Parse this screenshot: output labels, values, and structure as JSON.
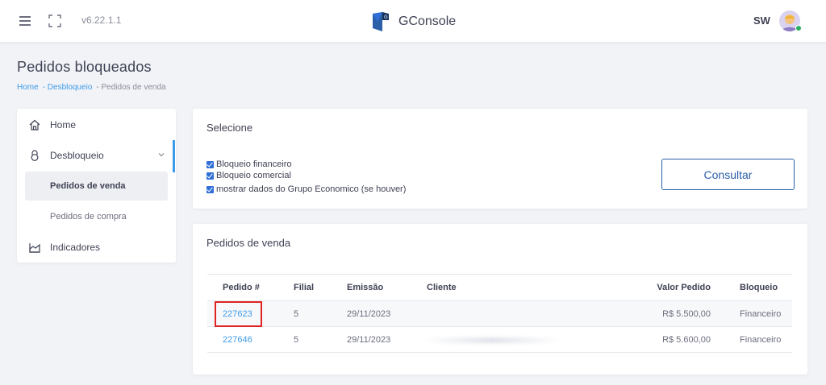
{
  "topbar": {
    "version": "v6.22.1.1",
    "brand_name": "GConsole",
    "user_initials": "SW"
  },
  "page": {
    "title": "Pedidos bloqueados",
    "breadcrumb": [
      "Home",
      "- Desbloqueio",
      "- Pedidos de venda"
    ]
  },
  "sidebar": {
    "items": [
      {
        "label": "Home",
        "icon": "home-icon"
      },
      {
        "label": "Desbloqueio",
        "icon": "lock-icon"
      },
      {
        "label": "Pedidos de venda"
      },
      {
        "label": "Pedidos de compra"
      },
      {
        "label": "Indicadores",
        "icon": "chart-icon"
      }
    ]
  },
  "filters": {
    "title": "Selecione",
    "options": [
      {
        "label": "Bloqueio financeiro",
        "checked": true
      },
      {
        "label": "Bloqueio comercial",
        "checked": true
      },
      {
        "label": "mostrar dados do Grupo Economico (se houver)",
        "checked": true
      }
    ],
    "submit_label": "Consultar"
  },
  "orders": {
    "title": "Pedidos de venda",
    "columns": [
      "Pedido #",
      "Filial",
      "Emissão",
      "Cliente",
      "Valor Pedido",
      "Bloqueio"
    ],
    "rows": [
      {
        "pedido": "227623",
        "filial": "5",
        "emissao": "29/11/2023",
        "cliente": "",
        "valor": "R$ 5.500,00",
        "bloqueio": "Financeiro"
      },
      {
        "pedido": "227646",
        "filial": "5",
        "emissao": "29/11/2023",
        "cliente": "",
        "valor": "R$ 5.600,00",
        "bloqueio": "Financeiro"
      }
    ]
  },
  "colors": {
    "accent": "#3d9be9",
    "button_border": "#2b5fa8",
    "highlight": "#e02424",
    "status_online": "#27ae60"
  }
}
